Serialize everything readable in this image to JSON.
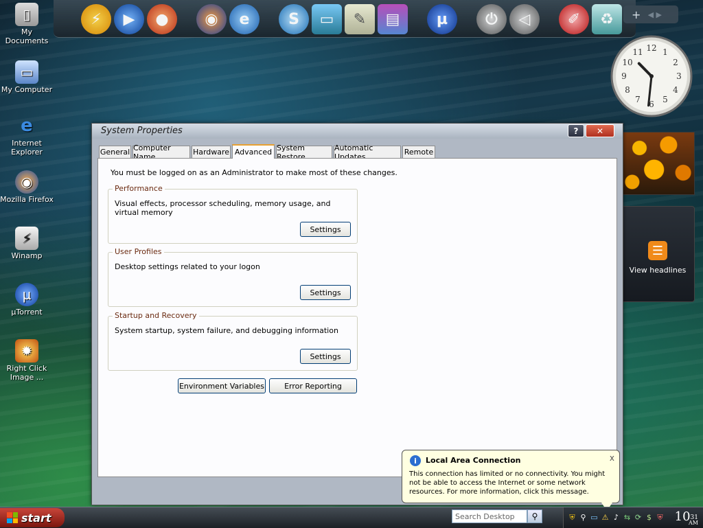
{
  "desktop": {
    "icons": [
      {
        "label": "My Documents",
        "icon": "folder-icon"
      },
      {
        "label": "My Computer",
        "icon": "computer-icon"
      },
      {
        "label": "Internet Explorer",
        "icon": "ie-icon"
      },
      {
        "label": "Mozilla Firefox",
        "icon": "firefox-icon"
      },
      {
        "label": "Winamp",
        "icon": "winamp-icon"
      },
      {
        "label": "µTorrent",
        "icon": "utorrent-icon"
      },
      {
        "label": "Right Click Image ...",
        "icon": "right-click-image-icon"
      }
    ]
  },
  "dock": {
    "plus_label": "+"
  },
  "gadgets": {
    "clock": {
      "hour": 10,
      "minute": 31
    },
    "rss_label": "View headlines"
  },
  "dialog": {
    "title": "System Properties",
    "help_label": "?",
    "close_label": "✕",
    "tabs": [
      "General",
      "Computer Name",
      "Hardware",
      "Advanced",
      "System Restore",
      "Automatic Updates",
      "Remote"
    ],
    "active_tab": "Advanced",
    "intro": "You must be logged on as an Administrator to make most of these changes.",
    "performance": {
      "legend": "Performance",
      "desc": "Visual effects, processor scheduling, memory usage, and virtual memory",
      "button": "Settings"
    },
    "user_profiles": {
      "legend": "User Profiles",
      "desc": "Desktop settings related to your logon",
      "button": "Settings"
    },
    "startup": {
      "legend": "Startup and Recovery",
      "desc": "System startup, system failure, and debugging information",
      "button": "Settings"
    },
    "env_vars_button": "Environment Variables",
    "error_reporting_button": "Error Reporting"
  },
  "balloon": {
    "title": "Local Area Connection",
    "text": "This connection has limited or no connectivity. You might not be able to access the Internet or some network resources. For more information, click this message.",
    "close_label": "x"
  },
  "taskbar": {
    "start_label": "start",
    "search_placeholder": "Search Desktop",
    "clock_time": "10",
    "clock_min": "31",
    "clock_ampm": "AM"
  },
  "colors": {
    "tab_highlight": "#e8a030",
    "start_button": "#b0321f",
    "balloon_bg": "#ffffe1"
  }
}
